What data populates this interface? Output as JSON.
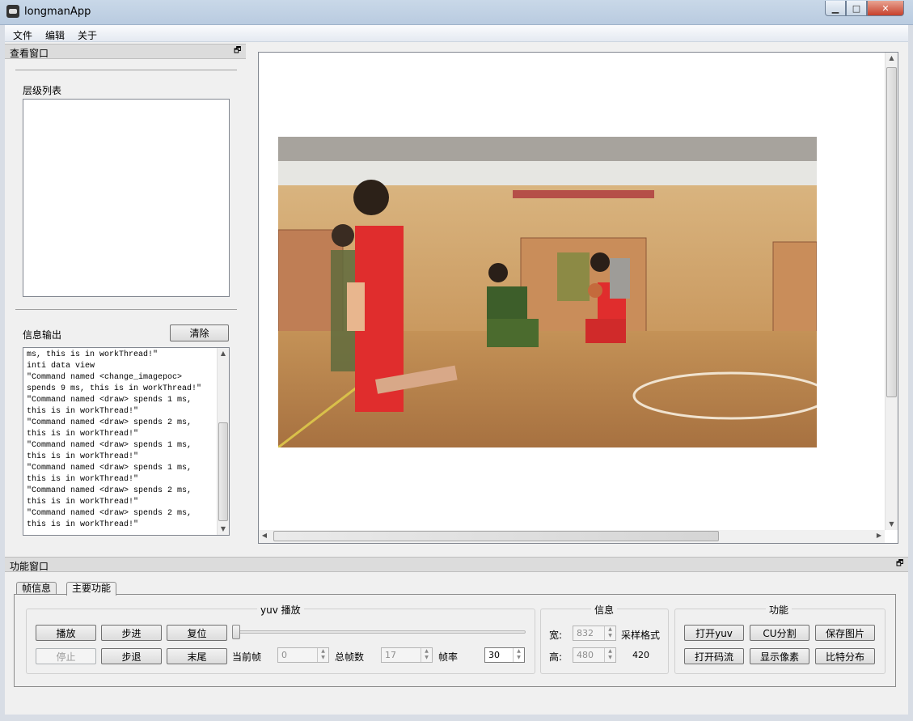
{
  "window": {
    "title": "longmanApp"
  },
  "menu": {
    "items": [
      "文件",
      "编辑",
      "关于"
    ]
  },
  "view_dock": {
    "title": "查看窗口",
    "layer_list_label": "层级列表",
    "info_output_label": "信息输出",
    "clear_button": "清除",
    "log_lines": [
      "ms, this is in workThread!\"",
      "inti data view",
      "\"Command named <change_imagepoc>",
      "spends 9 ms, this is in workThread!\"",
      "\"Command named <draw> spends 1 ms,",
      "this is in workThread!\"",
      "\"Command named <draw> spends 2 ms,",
      "this is in workThread!\"",
      "\"Command named <draw> spends 1 ms,",
      "this is in workThread!\"",
      "\"Command named <draw> spends 1 ms,",
      "this is in workThread!\"",
      "\"Command named <draw> spends 2 ms,",
      "this is in workThread!\"",
      "\"Command named <draw> spends 2 ms,",
      "this is in workThread!\""
    ]
  },
  "function_dock": {
    "title": "功能窗口",
    "tabs": [
      "帧信息",
      "主要功能"
    ],
    "playback": {
      "title": "yuv 播放",
      "buttons": {
        "play": "播放",
        "step_fwd": "步进",
        "reset": "复位",
        "stop": "停止",
        "step_back": "步退",
        "end": "末尾"
      },
      "current_frame_label": "当前帧",
      "current_frame": "0",
      "total_frames_label": "总帧数",
      "total_frames": "17",
      "fps_label": "帧率",
      "fps": "30",
      "slider_position": 0
    },
    "info": {
      "title": "信息",
      "width_label": "宽:",
      "width": "832",
      "height_label": "高:",
      "height": "480",
      "sampling_label": "采样格式",
      "sampling": "420"
    },
    "functions": {
      "title": "功能",
      "buttons": [
        "打开yuv",
        "CU分割",
        "保存图片",
        "打开码流",
        "显示像素",
        "比特分布"
      ]
    }
  },
  "colors": {
    "titlebar": "#c9d8e8",
    "jersey_red": "#e02d2d",
    "jersey_green": "#3d5e2a",
    "floor": "#c08a54"
  }
}
